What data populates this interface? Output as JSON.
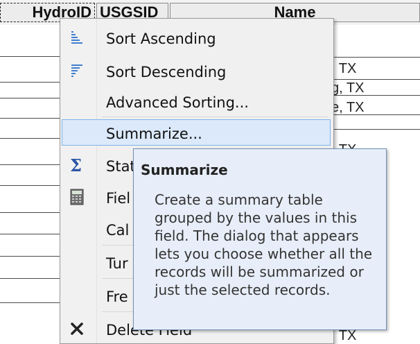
{
  "table": {
    "columns": [
      "HydroID",
      "USGSID",
      "Name"
    ],
    "visible_cells": [
      ", TX",
      "g, TX",
      "e, TX",
      ", TX",
      ", TX"
    ]
  },
  "menu": {
    "items": [
      {
        "label": "Sort Ascending",
        "icon": "sort-ascending-icon"
      },
      {
        "label": "Sort Descending",
        "icon": "sort-descending-icon"
      },
      {
        "label": "Advanced Sorting...",
        "icon": ""
      },
      {
        "label": "Summarize...",
        "icon": ""
      },
      {
        "label": "Stat",
        "icon": "sigma-icon"
      },
      {
        "label": "Fiel",
        "icon": "calculator-icon"
      },
      {
        "label": "Cal",
        "icon": ""
      },
      {
        "label": "Tur",
        "icon": ""
      },
      {
        "label": "Fre",
        "icon": ""
      },
      {
        "label": "Delete Field",
        "icon": "delete-x-icon"
      }
    ],
    "highlighted": "Summarize..."
  },
  "tooltip": {
    "title": "Summarize",
    "body": "Create a summary table grouped by the values in this field. The dialog that appears lets you choose whether all the records will be summarized or just the selected records."
  },
  "colors": {
    "highlight_bg": "#dbe9fb",
    "highlight_border": "#7fb3e8",
    "tooltip_bg": "#e8eef9",
    "tooltip_border": "#6f8fb7"
  }
}
